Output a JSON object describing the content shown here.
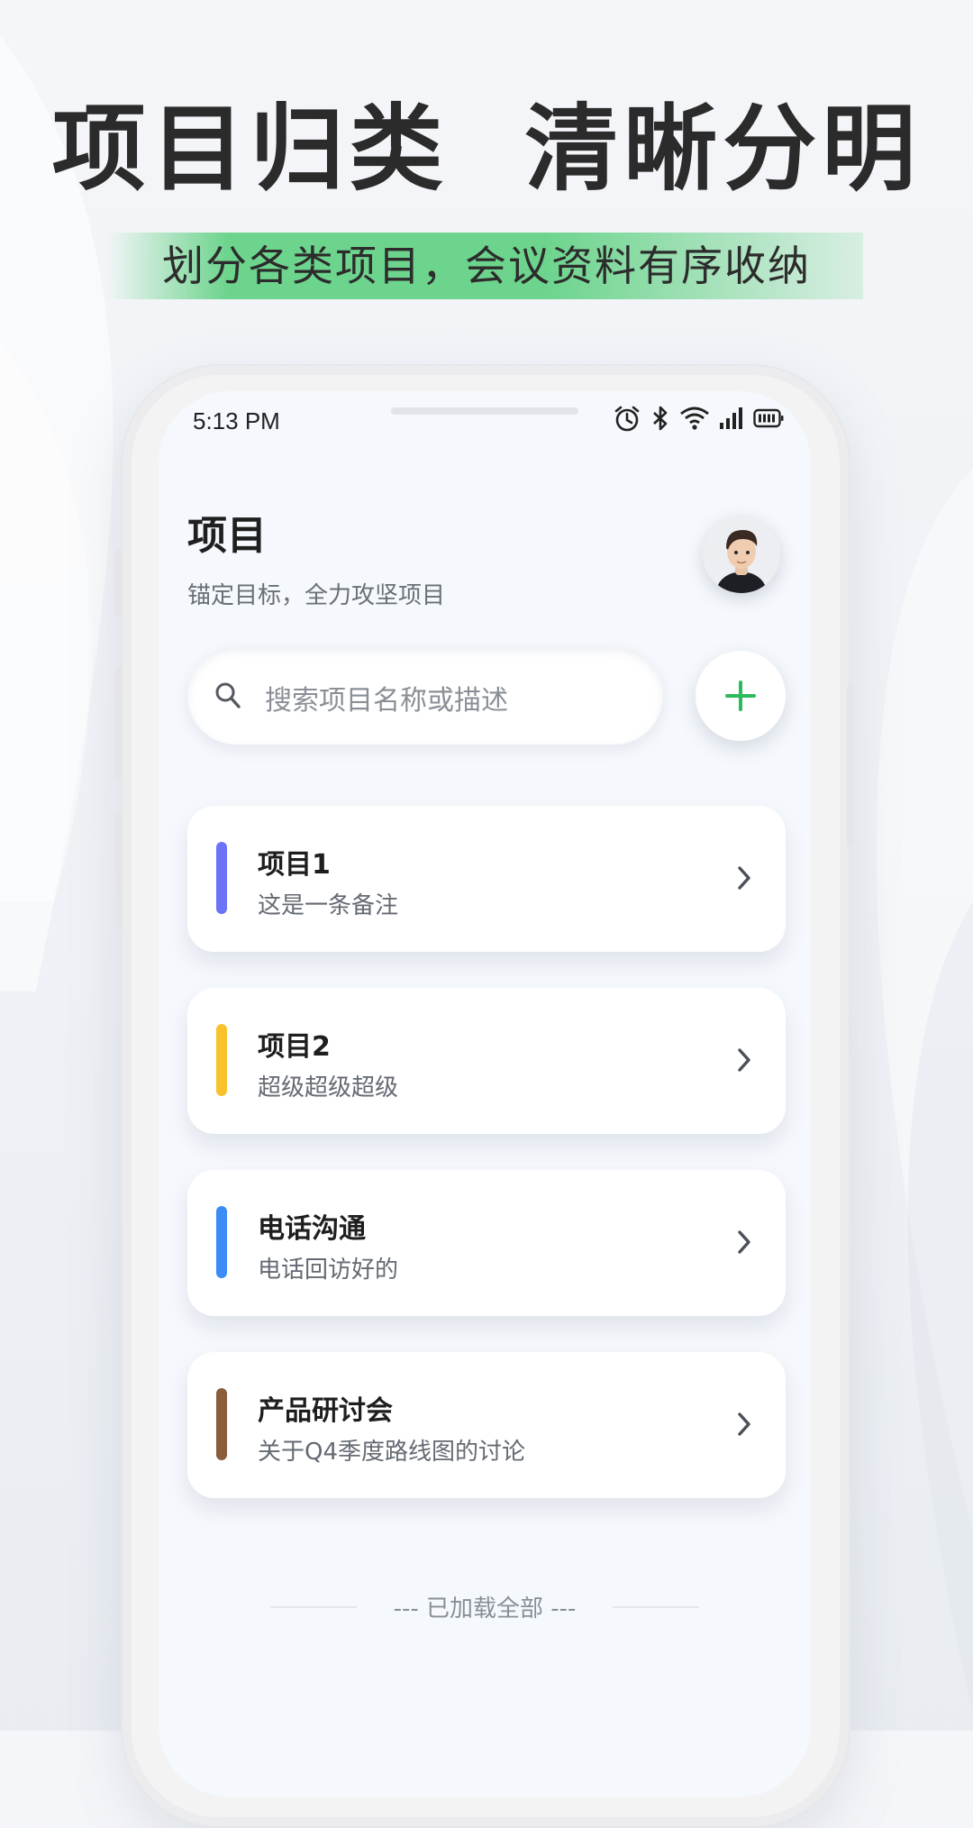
{
  "promo": {
    "title": "项目归类  清晰分明",
    "subtitle": "划分各类项目，会议资料有序收纳",
    "highlight_color": "#40c969"
  },
  "status_bar": {
    "time": "5:13 PM",
    "icons": [
      "alarm-icon",
      "bluetooth-icon",
      "wifi-icon",
      "signal-icon",
      "battery-icon"
    ]
  },
  "header": {
    "title": "项目",
    "subtitle": "锚定目标，全力攻坚项目",
    "avatar_icon": "user-avatar"
  },
  "search": {
    "placeholder": "搜索项目名称或描述",
    "icon": "search-icon"
  },
  "add_button": {
    "icon": "plus-icon",
    "color": "#2bbb5b"
  },
  "projects": [
    {
      "title": "项目1",
      "desc": "这是一条备注",
      "color": "#6b73f6"
    },
    {
      "title": "项目2",
      "desc": "超级超级超级",
      "color": "#f7c22c"
    },
    {
      "title": "电话沟通",
      "desc": "电话回访好的",
      "color": "#3c8cf5"
    },
    {
      "title": "产品研讨会",
      "desc": "关于Q4季度路线图的讨论",
      "color": "#8a5d3b"
    }
  ],
  "footer": {
    "end_text": "--- 已加载全部 ---"
  }
}
